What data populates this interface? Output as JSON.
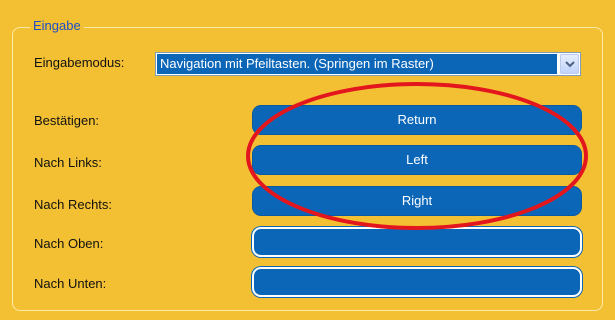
{
  "group": {
    "title": "Eingabe"
  },
  "mode": {
    "label": "Eingabemodus:",
    "value": "Navigation mit Pfeiltasten.  (Springen im Raster)"
  },
  "bindings": [
    {
      "label": "Bestätigen:",
      "key": "Return"
    },
    {
      "label": "Nach Links:",
      "key": "Left"
    },
    {
      "label": "Nach Rechts:",
      "key": "Right"
    },
    {
      "label": "Nach Oben:",
      "key": ""
    },
    {
      "label": "Nach Unten:",
      "key": ""
    }
  ],
  "annotation": {
    "type": "red-ellipse",
    "color": "#e3161e"
  },
  "colors": {
    "background": "#f3c033",
    "button": "#0b66b8",
    "legend_text": "#1e4fc9"
  }
}
